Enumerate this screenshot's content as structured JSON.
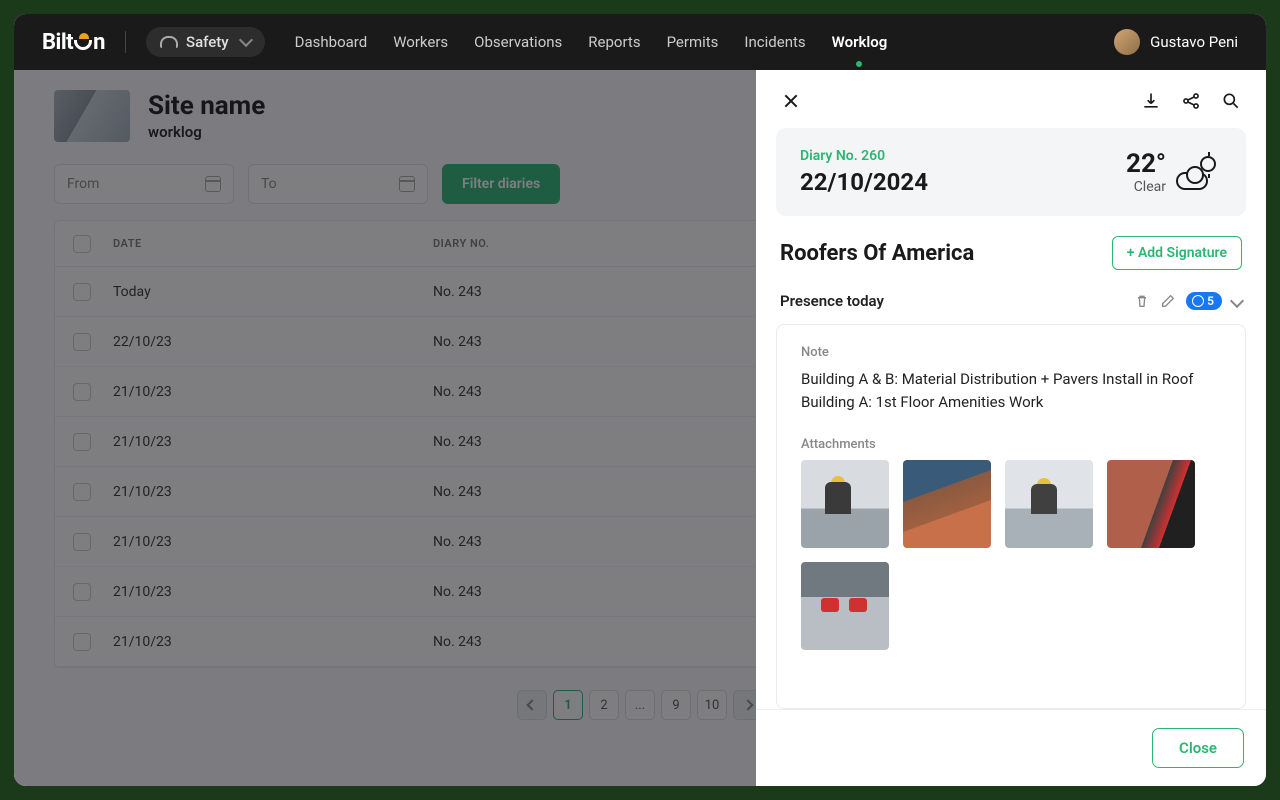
{
  "brand": "BiltOn",
  "safety_label": "Safety",
  "nav": {
    "dashboard": "Dashboard",
    "workers": "Workers",
    "observations": "Observations",
    "reports": "Reports",
    "permits": "Permits",
    "incidents": "Incidents",
    "worklog": "Worklog"
  },
  "user_name": "Gustavo Peni",
  "site": {
    "name": "Site name",
    "sub": "worklog"
  },
  "filters": {
    "from": "From",
    "to": "To",
    "button": "Filter diaries"
  },
  "columns": {
    "date": "DATE",
    "diary": "DIARY NO."
  },
  "rows": [
    {
      "date": "Today",
      "diary": "No. 243"
    },
    {
      "date": "22/10/23",
      "diary": "No. 243"
    },
    {
      "date": "21/10/23",
      "diary": "No. 243"
    },
    {
      "date": "21/10/23",
      "diary": "No. 243"
    },
    {
      "date": "21/10/23",
      "diary": "No. 243"
    },
    {
      "date": "21/10/23",
      "diary": "No. 243"
    },
    {
      "date": "21/10/23",
      "diary": "No. 243"
    },
    {
      "date": "21/10/23",
      "diary": "No. 243"
    }
  ],
  "pagination": {
    "p1": "1",
    "p2": "2",
    "dots": "...",
    "p9": "9",
    "p10": "10"
  },
  "panel": {
    "diary_no": "Diary No. 260",
    "date": "22/10/2024",
    "temp": "22°",
    "cond": "Clear",
    "company": "Roofers Of America",
    "add_signature": "+ Add Signature",
    "presence_label": "Presence today",
    "presence_count": "5",
    "note_label": "Note",
    "note_text": "Building A & B: Material Distribution + Pavers Install in Roof Building A: 1st Floor Amenities Work",
    "attachments_label": "Attachments",
    "close": "Close"
  }
}
